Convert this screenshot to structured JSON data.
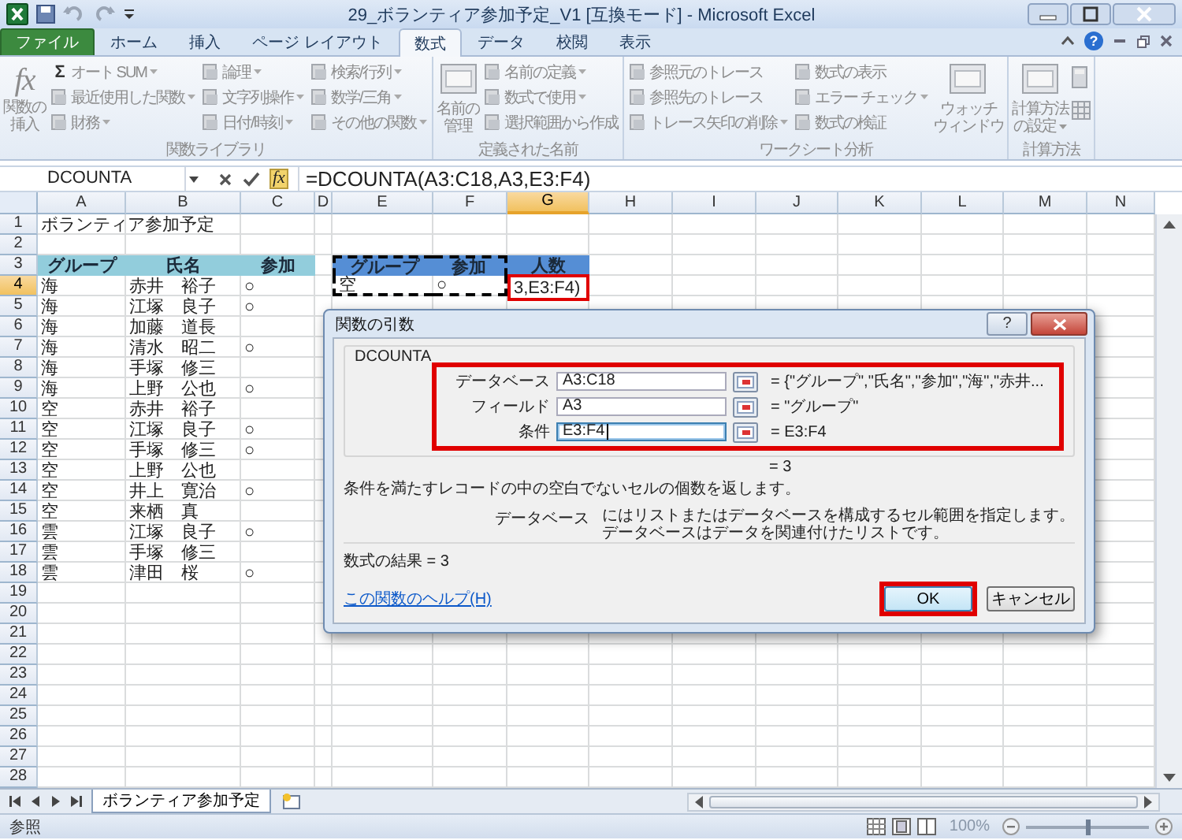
{
  "window": {
    "title": "29_ボランティア参加予定_V1  [互換モード] - Microsoft Excel",
    "help": "?"
  },
  "tabs": [
    {
      "label": "ファイル",
      "kind": "file",
      "selected": false
    },
    {
      "label": "ホーム",
      "kind": "tab",
      "selected": false
    },
    {
      "label": "挿入",
      "kind": "tab",
      "selected": false
    },
    {
      "label": "ページ レイアウト",
      "kind": "tab",
      "selected": false
    },
    {
      "label": "数式",
      "kind": "tab",
      "selected": true
    },
    {
      "label": "データ",
      "kind": "tab",
      "selected": false
    },
    {
      "label": "校閲",
      "kind": "tab",
      "selected": false
    },
    {
      "label": "表示",
      "kind": "tab",
      "selected": false
    }
  ],
  "ribbon": [
    {
      "label": "関数ライブラリ",
      "columns": [
        {
          "kind": "large",
          "glyph": "fx",
          "lines": [
            "関数の",
            "挿入"
          ],
          "dropdown": false
        },
        {
          "kind": "stack",
          "items": [
            {
              "glyph": "Σ",
              "label": "オート SUM",
              "dropdown": true
            },
            {
              "label": "最近使用した関数",
              "dropdown": true
            },
            {
              "label": "財務",
              "dropdown": true
            }
          ]
        },
        {
          "kind": "stack",
          "items": [
            {
              "label": "論理",
              "dropdown": true
            },
            {
              "label": "文字列操作",
              "dropdown": true
            },
            {
              "label": "日付/時刻",
              "dropdown": true
            }
          ]
        },
        {
          "kind": "stack",
          "items": [
            {
              "label": "検索/行列",
              "dropdown": true
            },
            {
              "label": "数学/三角",
              "dropdown": true
            },
            {
              "label": "その他の関数",
              "dropdown": true
            }
          ]
        }
      ]
    },
    {
      "label": "定義された名前",
      "columns": [
        {
          "kind": "large",
          "lines": [
            "名前の",
            "管理"
          ],
          "dropdown": false
        },
        {
          "kind": "stack",
          "items": [
            {
              "label": "名前の定義",
              "dropdown": true
            },
            {
              "label": "数式で使用",
              "dropdown": true
            },
            {
              "label": "選択範囲から作成",
              "dropdown": false
            }
          ]
        }
      ]
    },
    {
      "label": "ワークシート分析",
      "columns": [
        {
          "kind": "stack",
          "items": [
            {
              "label": "参照元のトレース",
              "dropdown": false
            },
            {
              "label": "参照先のトレース",
              "dropdown": false
            },
            {
              "label": "トレース矢印の削除",
              "dropdown": true
            }
          ]
        },
        {
          "kind": "stack",
          "items": [
            {
              "label": "数式の表示",
              "dropdown": false
            },
            {
              "label": "エラー チェック",
              "dropdown": true
            },
            {
              "label": "数式の検証",
              "dropdown": false
            }
          ]
        },
        {
          "kind": "large",
          "lines": [
            "ウォッチ",
            "ウィンドウ"
          ],
          "dropdown": false
        }
      ]
    },
    {
      "label": "計算方法",
      "columns": [
        {
          "kind": "large",
          "lines": [
            "計算方法",
            "の設定"
          ],
          "dropdown": true
        },
        {
          "kind": "icons"
        }
      ]
    }
  ],
  "formula_bar": {
    "name_box": "DCOUNTA",
    "function_glyph": "fx",
    "formula": "=DCOUNTA(A3:C18,A3,E3:F4)"
  },
  "sheet": {
    "columns": [
      {
        "label": "A",
        "active": false
      },
      {
        "label": "B",
        "active": false
      },
      {
        "label": "C",
        "active": false
      },
      {
        "label": "D",
        "active": false
      },
      {
        "label": "E",
        "active": false
      },
      {
        "label": "F",
        "active": false
      },
      {
        "label": "G",
        "active": true
      },
      {
        "label": "H",
        "active": false
      },
      {
        "label": "I",
        "active": false
      },
      {
        "label": "J",
        "active": false
      },
      {
        "label": "K",
        "active": false
      },
      {
        "label": "L",
        "active": false
      },
      {
        "label": "M",
        "active": false
      },
      {
        "label": "N",
        "active": false
      }
    ],
    "rows": [
      {
        "label": "1",
        "active": false,
        "cells": [
          {
            "kind": "text",
            "text": "ボランティア参加予定"
          }
        ]
      },
      {
        "label": "2",
        "active": false
      },
      {
        "label": "3",
        "active": false,
        "cells": [
          {
            "kind": "header",
            "text": "グループ",
            "color": "#92cddc",
            "marquee": false
          },
          {
            "kind": "header",
            "text": "氏名",
            "color": "#92cddc",
            "marquee": false
          },
          {
            "kind": "header",
            "text": "参加",
            "color": "#92cddc",
            "marquee": false
          },
          null,
          {
            "kind": "header",
            "text": "グループ",
            "color": "#558ed5",
            "marquee": true
          },
          {
            "kind": "header",
            "text": "参加",
            "color": "#558ed5",
            "marquee": true
          },
          {
            "kind": "header",
            "text": "人数",
            "color": "#558ed5",
            "marquee": false
          }
        ]
      },
      {
        "label": "4",
        "active": true,
        "cells": [
          {
            "kind": "text",
            "text": "海",
            "marquee": false
          },
          {
            "kind": "text",
            "text": "赤井　裕子",
            "marquee": false
          },
          {
            "kind": "text",
            "text": "○",
            "marquee": false
          },
          null,
          {
            "kind": "text",
            "text": "空",
            "marquee": true
          },
          {
            "kind": "text",
            "text": "○",
            "marquee": true
          },
          {
            "kind": "editing",
            "text": "3,E3:F4)",
            "marquee": false
          }
        ]
      },
      {
        "label": "5",
        "active": false,
        "cells": [
          {
            "kind": "text",
            "text": "海"
          },
          {
            "kind": "text",
            "text": "江塚　良子"
          },
          {
            "kind": "text",
            "text": "○"
          }
        ]
      },
      {
        "label": "6",
        "active": false,
        "cells": [
          {
            "kind": "text",
            "text": "海"
          },
          {
            "kind": "text",
            "text": "加藤　道長"
          }
        ]
      },
      {
        "label": "7",
        "active": false,
        "cells": [
          {
            "kind": "text",
            "text": "海"
          },
          {
            "kind": "text",
            "text": "清水　昭二"
          },
          {
            "kind": "text",
            "text": "○"
          }
        ]
      },
      {
        "label": "8",
        "active": false,
        "cells": [
          {
            "kind": "text",
            "text": "海"
          },
          {
            "kind": "text",
            "text": "手塚　修三"
          }
        ]
      },
      {
        "label": "9",
        "active": false,
        "cells": [
          {
            "kind": "text",
            "text": "海"
          },
          {
            "kind": "text",
            "text": "上野　公也"
          },
          {
            "kind": "text",
            "text": "○"
          }
        ]
      },
      {
        "label": "10",
        "active": false,
        "cells": [
          {
            "kind": "text",
            "text": "空"
          },
          {
            "kind": "text",
            "text": "赤井　裕子"
          }
        ]
      },
      {
        "label": "11",
        "active": false,
        "cells": [
          {
            "kind": "text",
            "text": "空"
          },
          {
            "kind": "text",
            "text": "江塚　良子"
          },
          {
            "kind": "text",
            "text": "○"
          }
        ]
      },
      {
        "label": "12",
        "active": false,
        "cells": [
          {
            "kind": "text",
            "text": "空"
          },
          {
            "kind": "text",
            "text": "手塚　修三"
          },
          {
            "kind": "text",
            "text": "○"
          }
        ]
      },
      {
        "label": "13",
        "active": false,
        "cells": [
          {
            "kind": "text",
            "text": "空"
          },
          {
            "kind": "text",
            "text": "上野　公也"
          }
        ]
      },
      {
        "label": "14",
        "active": false,
        "cells": [
          {
            "kind": "text",
            "text": "空"
          },
          {
            "kind": "text",
            "text": "井上　寛治"
          },
          {
            "kind": "text",
            "text": "○"
          }
        ]
      },
      {
        "label": "15",
        "active": false,
        "cells": [
          {
            "kind": "text",
            "text": "空"
          },
          {
            "kind": "text",
            "text": "来栖　真"
          }
        ]
      },
      {
        "label": "16",
        "active": false,
        "cells": [
          {
            "kind": "text",
            "text": "雲"
          },
          {
            "kind": "text",
            "text": "江塚　良子"
          },
          {
            "kind": "text",
            "text": "○"
          }
        ]
      },
      {
        "label": "17",
        "active": false,
        "cells": [
          {
            "kind": "text",
            "text": "雲"
          },
          {
            "kind": "text",
            "text": "手塚　修三"
          }
        ]
      },
      {
        "label": "18",
        "active": false,
        "cells": [
          {
            "kind": "text",
            "text": "雲"
          },
          {
            "kind": "text",
            "text": "津田　桜"
          },
          {
            "kind": "text",
            "text": "○"
          }
        ]
      },
      {
        "label": "19",
        "active": false
      },
      {
        "label": "20",
        "active": false
      },
      {
        "label": "21",
        "active": false
      },
      {
        "label": "22",
        "active": false
      },
      {
        "label": "23",
        "active": false
      },
      {
        "label": "24",
        "active": false
      },
      {
        "label": "25",
        "active": false
      },
      {
        "label": "26",
        "active": false
      },
      {
        "label": "27",
        "active": false
      },
      {
        "label": "28",
        "active": false
      }
    ]
  },
  "dialog": {
    "title": "関数の引数",
    "help": "?",
    "function": "DCOUNTA",
    "arguments_highlighted": true,
    "arguments": [
      {
        "label": "データベース",
        "value": "A3:C18",
        "result": "= {\"グループ\",\"氏名\",\"参加\",\"海\",\"赤井...",
        "focused": false
      },
      {
        "label": "フィールド",
        "value": "A3",
        "result": "= \"グループ\"",
        "focused": false
      },
      {
        "label": "条件",
        "value": "E3:F4",
        "result": "= E3:F4",
        "focused": true
      }
    ],
    "result": "= 3",
    "description": "条件を満たすレコードの中の空白でないセルの個数を返します。",
    "argument_help": {
      "name": "データベース",
      "text": "にはリストまたはデータベースを構成するセル範囲を指定します。データベースはデータを関連付けたリストです。"
    },
    "formula_result": "数式の結果 =  3",
    "help_link": "この関数のヘルプ(H)",
    "buttons": [
      {
        "label": "OK",
        "highlighted": true
      },
      {
        "label": "キャンセル",
        "highlighted": false
      }
    ]
  },
  "sheet_tabs": [
    {
      "label": "ボランティア参加予定",
      "selected": true
    }
  ],
  "status_bar": {
    "mode": "参照",
    "zoom": "100%",
    "level": 0.5
  }
}
